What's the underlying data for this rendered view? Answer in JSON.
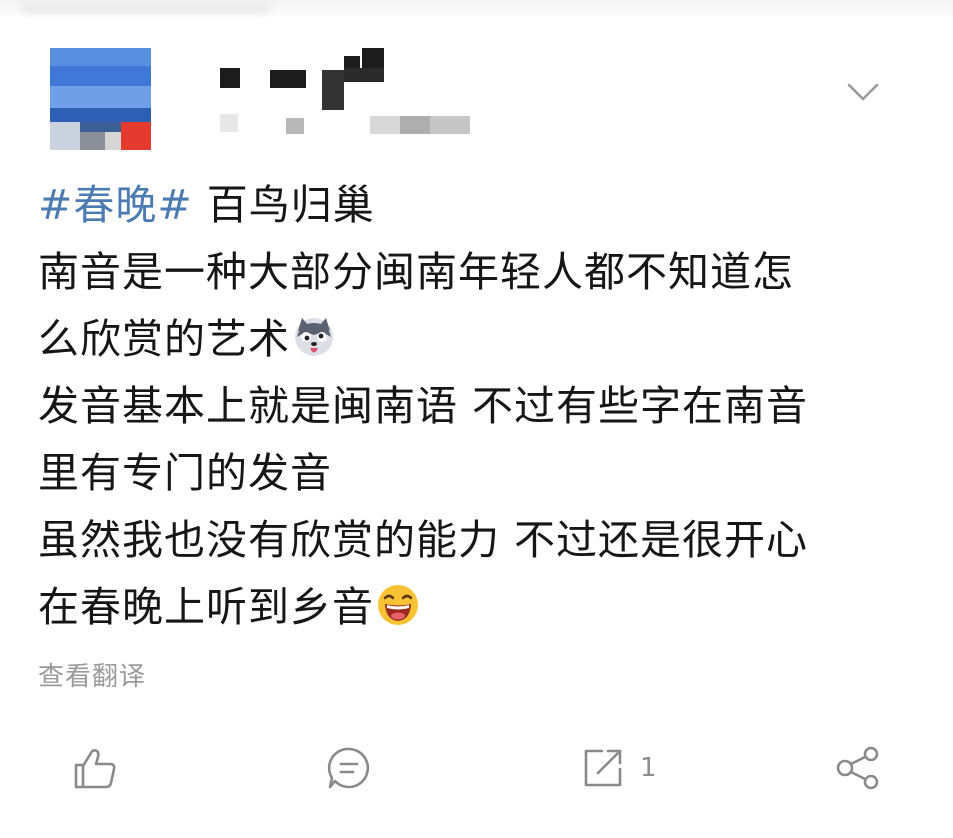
{
  "post": {
    "hashtag": "#春晚#",
    "title": " 百鸟归巢",
    "lines": [
      "南音是一种大部分闽南年轻人都不知道怎",
      "么欣赏的艺术",
      "发音基本上就是闽南语 不过有些字在南音",
      "里有专门的发音",
      "虽然我也没有欣赏的能力 不过还是很开心",
      "在春晚上听到乡音"
    ],
    "emojis": [
      "husky-emoji",
      "laughing-emoji"
    ]
  },
  "translate_label": "查看翻译",
  "actions": {
    "like_icon": "thumbs-up-icon",
    "comment_icon": "comment-bubble-icon",
    "repost_icon": "repost-icon",
    "repost_count": "1",
    "share_icon": "share-icon"
  },
  "colors": {
    "hashtag": "#4b7bb0",
    "text": "#161616",
    "muted": "#9a9a9a",
    "icon": "#8a8a8a"
  }
}
